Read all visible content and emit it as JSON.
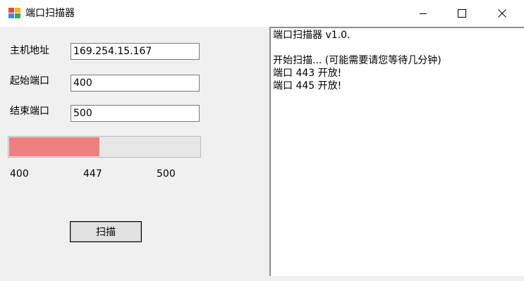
{
  "window": {
    "title": "端口扫描器",
    "icons": {
      "app": "app-icon",
      "minimize": "minimize-icon",
      "maximize": "maximize-icon",
      "close": "close-icon"
    }
  },
  "form": {
    "host_label": "主机地址",
    "host_value": "169.254.15.167",
    "start_label": "起始端口",
    "start_value": "400",
    "end_label": "结束端口",
    "end_value": "500"
  },
  "progress": {
    "min_label": "400",
    "current_label": "447",
    "max_label": "500",
    "fraction": 0.47,
    "fill_color": "#f08080"
  },
  "scan_button_label": "扫描",
  "log": {
    "lines": [
      "端口扫描器 v1.0.",
      "",
      "开始扫描... (可能需要请您等待几分钟)",
      "端口 443 开放!",
      "端口 445 开放!"
    ]
  }
}
